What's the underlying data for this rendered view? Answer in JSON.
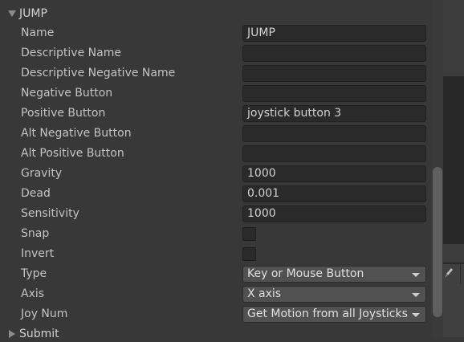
{
  "axis": {
    "name": "JUMP",
    "fields": {
      "name": {
        "label": "Name",
        "value": "JUMP"
      },
      "descriptive_name": {
        "label": "Descriptive Name",
        "value": ""
      },
      "descriptive_negative_name": {
        "label": "Descriptive Negative Name",
        "value": ""
      },
      "negative_button": {
        "label": "Negative Button",
        "value": ""
      },
      "positive_button": {
        "label": "Positive Button",
        "value": "joystick button 3"
      },
      "alt_negative_button": {
        "label": "Alt Negative Button",
        "value": ""
      },
      "alt_positive_button": {
        "label": "Alt Positive Button",
        "value": ""
      },
      "gravity": {
        "label": "Gravity",
        "value": "1000"
      },
      "dead": {
        "label": "Dead",
        "value": "0.001"
      },
      "sensitivity": {
        "label": "Sensitivity",
        "value": "1000"
      },
      "snap": {
        "label": "Snap",
        "checked": false
      },
      "invert": {
        "label": "Invert",
        "checked": false
      },
      "type": {
        "label": "Type",
        "value": "Key or Mouse Button"
      },
      "axis": {
        "label": "Axis",
        "value": "X axis"
      },
      "joy_num": {
        "label": "Joy Num",
        "value": "Get Motion from all Joysticks"
      }
    }
  },
  "next_section": {
    "name": "Submit"
  },
  "icons": {
    "foldout_expanded": "triangle-down-icon",
    "foldout_collapsed": "triangle-right-icon",
    "tool": "brush-icon"
  },
  "colors": {
    "background": "#383838",
    "field_bg": "#2a2a2a",
    "dropdown_bg": "#515151",
    "text": "#c4c4c4"
  }
}
